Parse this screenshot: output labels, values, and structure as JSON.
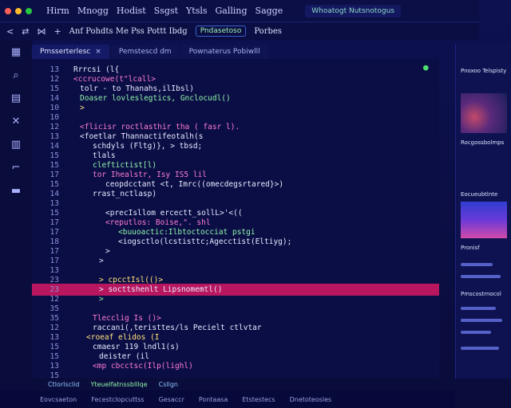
{
  "titlebar": {
    "menu": [
      "Hirm",
      "Mnogg",
      "Hodist",
      "Ssgst",
      "Ytsls",
      "Galling",
      "Sagge"
    ],
    "tab": "Whoatogt Nutsnotogus"
  },
  "toolbar": {
    "text": "Anf Pohdts Me Pss Pottt Ibdg",
    "chip": "Pndasetoso",
    "label": "Porbes"
  },
  "tabs": [
    {
      "label": "Pmsserterlesc",
      "active": true
    },
    {
      "label": "Pemstescd dm",
      "active": false
    },
    {
      "label": "Pownaterus Pobiwlll",
      "active": false
    }
  ],
  "code": [
    {
      "ln": "13",
      "text": "Rrrcsi (l{"
    },
    {
      "ln": "12",
      "text": "<ccrucowe(t\"lcall>"
    },
    {
      "ln": "15",
      "text": "tolr - to Thanahs,ilIbsl)"
    },
    {
      "ln": "14",
      "text": "Doaser lovleslegtics, Gnclocudl()"
    },
    {
      "ln": "10",
      "text": ">"
    },
    {
      "ln": "10",
      "text": ""
    },
    {
      "ln": "12",
      "text": "<flicisr roctlasthir tha ( fasr l)."
    },
    {
      "ln": "13",
      "text": "<foetlar Thannactifeotalh(s"
    },
    {
      "ln": "14",
      "text": "schdyls (Fltg)}, > tbsd;"
    },
    {
      "ln": "15",
      "text": "tlals"
    },
    {
      "ln": "15",
      "text": "cleftictist[l)"
    },
    {
      "ln": "17",
      "text": "tor Ihealstr, Isy IS5 lil"
    },
    {
      "ln": "15",
      "text": "ceopdcctant <t, Imrc((omecdegsrtared}>)"
    },
    {
      "ln": "14",
      "text": "rrast_nctlasp)"
    },
    {
      "ln": "13",
      "text": ""
    },
    {
      "ln": "15",
      "text": "<precIsllom ercectt_sollL>'<(("
    },
    {
      "ln": "17",
      "text": "<reputlos: Boise,\". shl"
    },
    {
      "ln": "17",
      "text": "<buuoactic:Ilbtoctocciat pstgi"
    },
    {
      "ln": "18",
      "text": "<iogsctlo(lcstisttc;Agecctist(Eltiyg);"
    },
    {
      "ln": "17",
      "text": ">"
    },
    {
      "ln": "17",
      "text": ">"
    },
    {
      "ln": "13",
      "text": ""
    },
    {
      "ln": "23",
      "text": "> cpcctIsl(()>"
    },
    {
      "ln": "23",
      "text": "> socttshenlt Lipsnomemtl()"
    },
    {
      "ln": "12",
      "text": ">"
    },
    {
      "ln": "35",
      "text": ""
    },
    {
      "ln": "35",
      "text": "Tlecclig Is ()>"
    },
    {
      "ln": "12",
      "text": "raccani(,teristtes/ls Pecielt ctlvtar"
    },
    {
      "ln": "13",
      "text": "<roeaf elidos (I"
    },
    {
      "ln": "15",
      "text": "cmaesr 119 lndl1(s)"
    },
    {
      "ln": "15",
      "text": "deister (il"
    },
    {
      "ln": "13",
      "text": "<mp cbcctsc(Ilp(lighl)"
    },
    {
      "ln": "15",
      "text": ""
    },
    {
      "ln": "13",
      "text": "> >"
    }
  ],
  "status": {
    "items": [
      "Ctlorlsclid",
      "Yteuelfatnssblllqe"
    ],
    "right": "Csllgn"
  },
  "bottombar": {
    "items": [
      "Eovcsaeton",
      "Fecestclopcuttss",
      "Gesaccr",
      "Pontaasa",
      "Etstestecs",
      "Dnetoteosles"
    ]
  },
  "right_panel": {
    "title": "Pnoxoo Telspisty",
    "labels": [
      "Rocgossbolmps",
      "Eocueubtlnte",
      "Pronisf",
      "Pmscostrnocol"
    ]
  },
  "colors": {
    "accent": "#b8175f",
    "keyword": "#ff7bd5",
    "string": "#ffe27a",
    "function": "#8ff3a9"
  }
}
